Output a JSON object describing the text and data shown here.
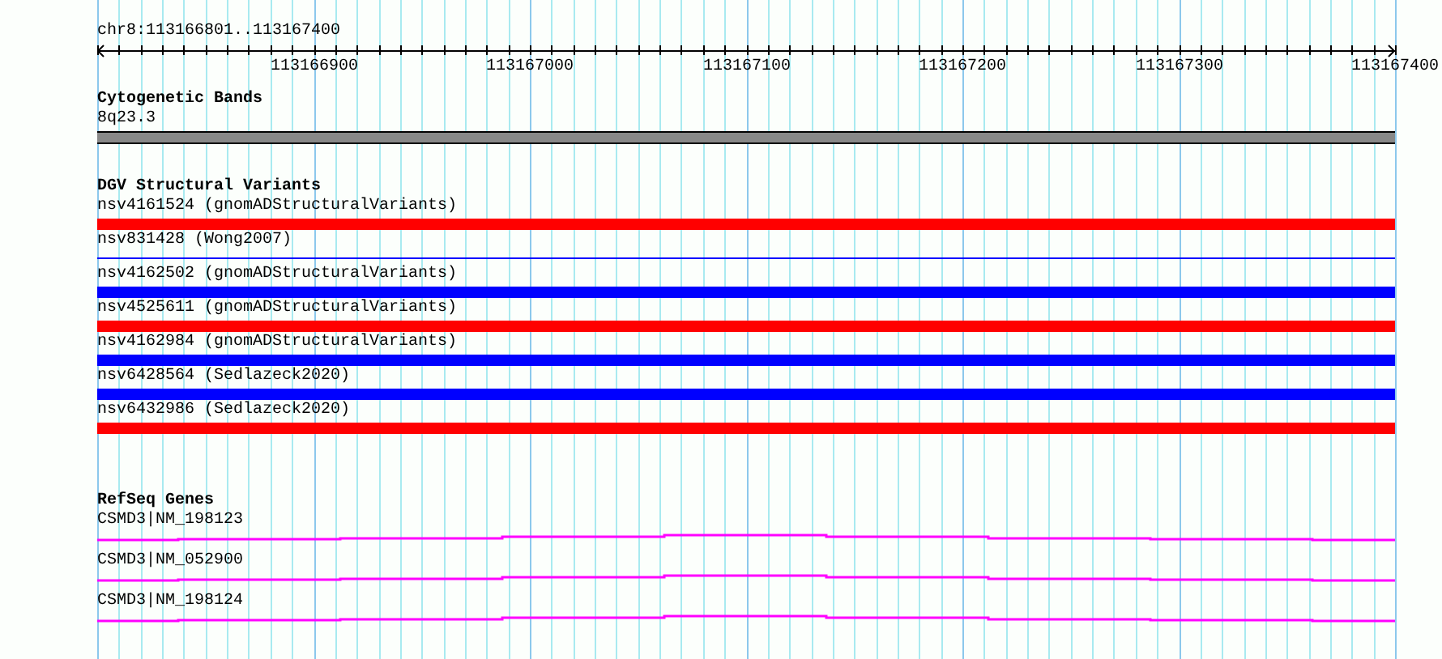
{
  "ruler": {
    "location": "chr8:113166801..113167400",
    "tick_labels": [
      "113166900",
      "113167000",
      "113167100",
      "113167200",
      "113167300",
      "113167400"
    ]
  },
  "cytogenetic_bands": {
    "title": "Cytogenetic Bands",
    "label": "8q23.3"
  },
  "dgv_structural_variants": {
    "title": "DGV Structural Variants",
    "items": [
      {
        "label": "nsv4161524 (gnomADStructuralVariants)",
        "kind": "thick",
        "color": "#ff0000"
      },
      {
        "label": "nsv831428 (Wong2007)",
        "kind": "thin",
        "color": "#0000ff"
      },
      {
        "label": "nsv4162502 (gnomADStructuralVariants)",
        "kind": "thick",
        "color": "#0000ff"
      },
      {
        "label": "nsv4525611 (gnomADStructuralVariants)",
        "kind": "thick",
        "color": "#ff0000"
      },
      {
        "label": "nsv4162984 (gnomADStructuralVariants)",
        "kind": "thick",
        "color": "#0000ff"
      },
      {
        "label": "nsv6428564 (Sedlazeck2020)",
        "kind": "thick",
        "color": "#0000ff"
      },
      {
        "label": "nsv6432986 (Sedlazeck2020)",
        "kind": "thick",
        "color": "#ff0000"
      }
    ]
  },
  "refseq_genes": {
    "title": "RefSeq Genes",
    "items": [
      {
        "label": "CSMD3|NM_198123"
      },
      {
        "label": "CSMD3|NM_052900"
      },
      {
        "label": "CSMD3|NM_198124"
      }
    ]
  }
}
